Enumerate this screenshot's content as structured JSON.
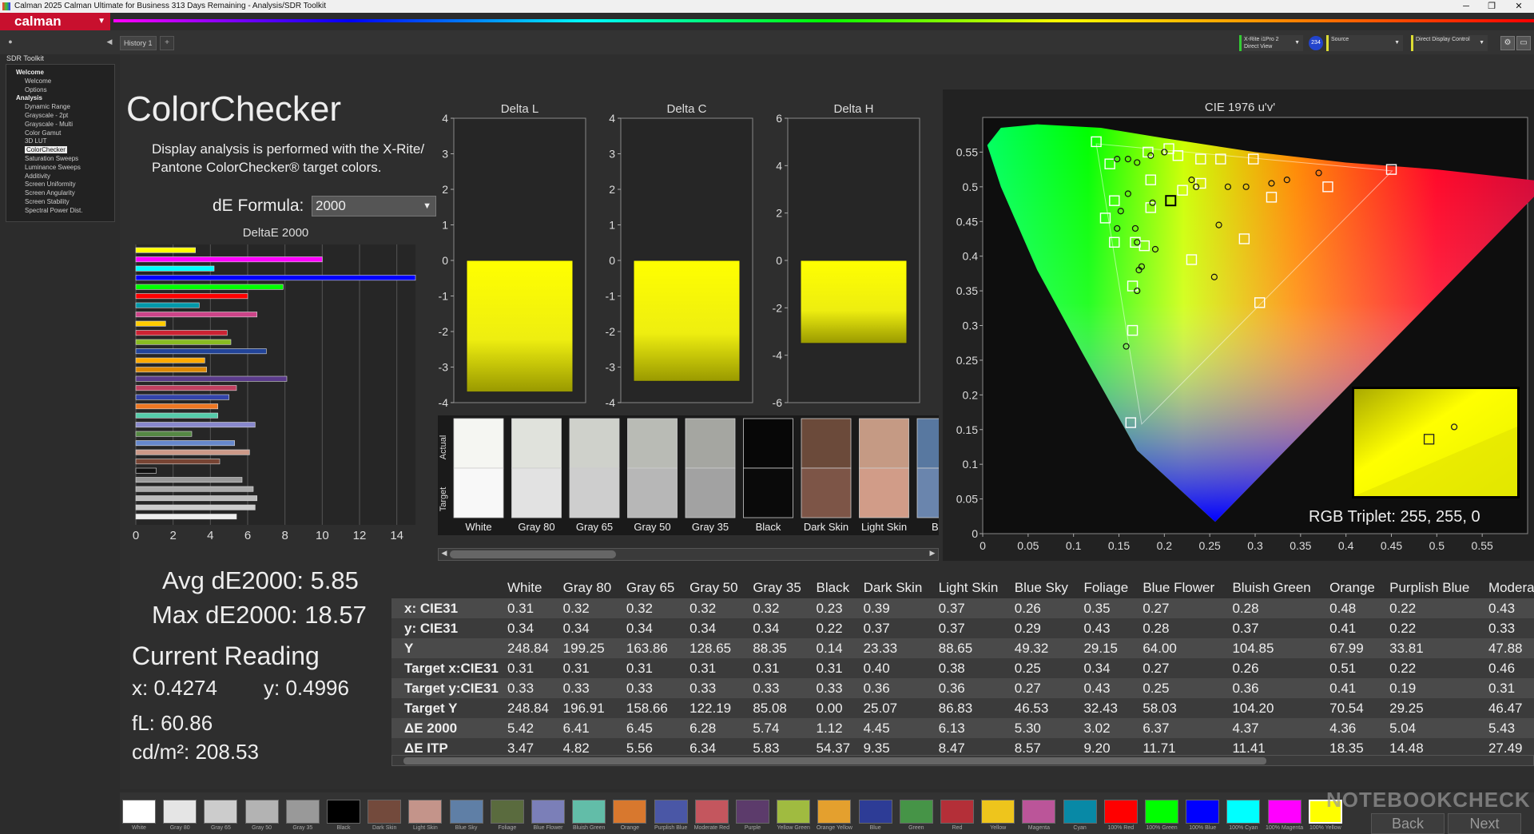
{
  "window": {
    "title": "Calman 2025 Calman Ultimate for Business 313 Days Remaining  - Analysis/SDR Toolkit",
    "minimize": "─",
    "restore": "❐",
    "close": "✕"
  },
  "brand": {
    "label": "calman"
  },
  "history_tab": "History 1",
  "history_add": "+",
  "devices": {
    "meter": {
      "line1": "X-Rite i1Pro 2",
      "line2": "Direct View"
    },
    "probe_badge": "234",
    "source": {
      "line1": "Source",
      "line2": ""
    },
    "display": {
      "line1": "Direct Display Control",
      "line2": ""
    }
  },
  "sidebar": {
    "header": "SDR Toolkit",
    "items": [
      {
        "label": "Welcome",
        "type": "section"
      },
      {
        "label": "Welcome",
        "type": "item"
      },
      {
        "label": "Options",
        "type": "item"
      },
      {
        "label": "Analysis",
        "type": "section"
      },
      {
        "label": "Dynamic Range",
        "type": "item"
      },
      {
        "label": "Grayscale - 2pt",
        "type": "item"
      },
      {
        "label": "Grayscale - Multi",
        "type": "item"
      },
      {
        "label": "Color Gamut",
        "type": "item"
      },
      {
        "label": "3D LUT",
        "type": "item"
      },
      {
        "label": "ColorChecker",
        "type": "selected"
      },
      {
        "label": "Saturation Sweeps",
        "type": "item"
      },
      {
        "label": "Luminance Sweeps",
        "type": "item"
      },
      {
        "label": "Additivity",
        "type": "item"
      },
      {
        "label": "Screen Uniformity",
        "type": "item"
      },
      {
        "label": "Screen Angularity",
        "type": "item"
      },
      {
        "label": "Screen Stability",
        "type": "item"
      },
      {
        "label": "Spectral Power Dist.",
        "type": "item"
      }
    ]
  },
  "page": {
    "title": "ColorChecker",
    "description": "Display analysis is performed with the X-Rite/ Pantone ColorChecker® target colors.",
    "de_formula_label": "dE Formula:",
    "de_formula_value": "2000",
    "avg": "Avg dE2000: 5.85",
    "max": "Max dE2000: 18.57",
    "current_reading_title": "Current Reading",
    "x": "x: 0.4274",
    "y": "y: 0.4996",
    "fl": "fL: 60.86",
    "cdm2": "cd/m²: 208.53"
  },
  "chart_data": [
    {
      "type": "bar",
      "title": "DeltaE 2000",
      "orientation": "horizontal",
      "xlim": [
        0,
        15
      ],
      "xticks": [
        0,
        2,
        4,
        6,
        8,
        10,
        12,
        14
      ],
      "bars": [
        {
          "value": 3.2,
          "color": "#ffff00"
        },
        {
          "value": 10.0,
          "color": "#ff00ff"
        },
        {
          "value": 4.2,
          "color": "#00ffff"
        },
        {
          "value": 15.0,
          "color": "#0000ff"
        },
        {
          "value": 7.9,
          "color": "#00ff00"
        },
        {
          "value": 6.0,
          "color": "#ff0000"
        },
        {
          "value": 3.4,
          "color": "#0099aa"
        },
        {
          "value": 6.5,
          "color": "#cc4488"
        },
        {
          "value": 1.6,
          "color": "#ffcc00"
        },
        {
          "value": 4.9,
          "color": "#cc2233"
        },
        {
          "value": 5.1,
          "color": "#88bb22"
        },
        {
          "value": 7.0,
          "color": "#224499"
        },
        {
          "value": 3.7,
          "color": "#ffaa00"
        },
        {
          "value": 3.8,
          "color": "#dd8800"
        },
        {
          "value": 8.1,
          "color": "#5a3a8a"
        },
        {
          "value": 5.4,
          "color": "#c04060"
        },
        {
          "value": 5.0,
          "color": "#3344aa"
        },
        {
          "value": 4.4,
          "color": "#ee7722"
        },
        {
          "value": 4.4,
          "color": "#55ccaa"
        },
        {
          "value": 6.4,
          "color": "#8888cc"
        },
        {
          "value": 3.0,
          "color": "#558844"
        },
        {
          "value": 5.3,
          "color": "#6688cc"
        },
        {
          "value": 6.1,
          "color": "#cc9988"
        },
        {
          "value": 4.5,
          "color": "#774433"
        },
        {
          "value": 1.1,
          "color": "#111111"
        },
        {
          "value": 5.7,
          "color": "#999999"
        },
        {
          "value": 6.3,
          "color": "#aaaaaa"
        },
        {
          "value": 6.5,
          "color": "#bbbbbb"
        },
        {
          "value": 6.4,
          "color": "#cccccc"
        },
        {
          "value": 5.4,
          "color": "#eeeeee"
        }
      ]
    },
    {
      "type": "bar",
      "title": "Delta L",
      "ylim": [
        -4,
        4
      ],
      "yticks": [
        4,
        3,
        2,
        1,
        0,
        -1,
        -2,
        -3,
        -4
      ],
      "values": [
        -3.7
      ]
    },
    {
      "type": "bar",
      "title": "Delta C",
      "ylim": [
        -4,
        4
      ],
      "yticks": [
        4,
        3,
        2,
        1,
        0,
        -1,
        -2,
        -3,
        -4
      ],
      "values": [
        -3.4
      ]
    },
    {
      "type": "bar",
      "title": "Delta H",
      "ylim": [
        -6,
        6
      ],
      "yticks": [
        6,
        4,
        2,
        0,
        -2,
        -4,
        -6
      ],
      "values": [
        -3.5
      ]
    },
    {
      "type": "scatter",
      "title": "CIE 1976 u'v'",
      "xlim": [
        0,
        0.6
      ],
      "ylim": [
        0,
        0.6
      ],
      "xticks": [
        "0",
        "0.05",
        "0.1",
        "0.15",
        "0.2",
        "0.25",
        "0.3",
        "0.35",
        "0.4",
        "0.45",
        "0.5",
        "0.55"
      ],
      "yticks": [
        "0.55",
        "0.5",
        "0.45",
        "0.4",
        "0.35",
        "0.3",
        "0.25",
        "0.2",
        "0.15",
        "0.1",
        "0.05",
        "0"
      ],
      "targets": [
        [
          0.125,
          0.565
        ],
        [
          0.14,
          0.533
        ],
        [
          0.145,
          0.48
        ],
        [
          0.135,
          0.455
        ],
        [
          0.145,
          0.42
        ],
        [
          0.168,
          0.42
        ],
        [
          0.178,
          0.415
        ],
        [
          0.165,
          0.357
        ],
        [
          0.165,
          0.293
        ],
        [
          0.163,
          0.16
        ],
        [
          0.185,
          0.47
        ],
        [
          0.185,
          0.51
        ],
        [
          0.182,
          0.55
        ],
        [
          0.205,
          0.555
        ],
        [
          0.215,
          0.545
        ],
        [
          0.24,
          0.54
        ],
        [
          0.24,
          0.505
        ],
        [
          0.22,
          0.495
        ],
        [
          0.262,
          0.54
        ],
        [
          0.298,
          0.54
        ],
        [
          0.318,
          0.485
        ],
        [
          0.38,
          0.5
        ],
        [
          0.45,
          0.525
        ],
        [
          0.288,
          0.425
        ],
        [
          0.23,
          0.395
        ],
        [
          0.305,
          0.333
        ]
      ],
      "measured": [
        [
          0.148,
          0.54
        ],
        [
          0.16,
          0.54
        ],
        [
          0.17,
          0.535
        ],
        [
          0.185,
          0.545
        ],
        [
          0.2,
          0.55
        ],
        [
          0.187,
          0.477
        ],
        [
          0.16,
          0.49
        ],
        [
          0.152,
          0.465
        ],
        [
          0.148,
          0.44
        ],
        [
          0.168,
          0.44
        ],
        [
          0.17,
          0.42
        ],
        [
          0.19,
          0.41
        ],
        [
          0.175,
          0.385
        ],
        [
          0.172,
          0.38
        ],
        [
          0.17,
          0.35
        ],
        [
          0.23,
          0.51
        ],
        [
          0.235,
          0.5
        ],
        [
          0.27,
          0.5
        ],
        [
          0.29,
          0.5
        ],
        [
          0.318,
          0.505
        ],
        [
          0.335,
          0.51
        ],
        [
          0.37,
          0.52
        ],
        [
          0.26,
          0.445
        ],
        [
          0.255,
          0.37
        ],
        [
          0.158,
          0.27
        ]
      ],
      "current": {
        "marker": [
          0.207,
          0.48
        ]
      },
      "inset": {
        "target": [
          0.46,
          0.47
        ],
        "measured": [
          0.61,
          0.36
        ]
      }
    }
  ],
  "rgb_triplet": "RGB Triplet: 255, 255, 0",
  "swatches": {
    "actual_label": "Actual",
    "target_label": "Target",
    "items": [
      {
        "name": "White",
        "actual": "#f5f6f2",
        "target": "#f8f8f8"
      },
      {
        "name": "Gray 80",
        "actual": "#e0e2dc",
        "target": "#e2e2e2"
      },
      {
        "name": "Gray 65",
        "actual": "#cfd1cb",
        "target": "#cecece"
      },
      {
        "name": "Gray 50",
        "actual": "#b9bbb5",
        "target": "#b7b7b7"
      },
      {
        "name": "Gray 35",
        "actual": "#a5a6a1",
        "target": "#a2a2a2"
      },
      {
        "name": "Black",
        "actual": "#070707",
        "target": "#0a0a0a"
      },
      {
        "name": "Dark Skin",
        "actual": "#6b4a3a",
        "target": "#7d5547"
      },
      {
        "name": "Light Skin",
        "actual": "#c59a84",
        "target": "#d19c88"
      },
      {
        "name": "Blue",
        "actual": "#5878a0",
        "target": "#6a85ad"
      }
    ]
  },
  "table": {
    "columns": [
      "",
      "White",
      "Gray 80",
      "Gray 65",
      "Gray 50",
      "Gray 35",
      "Black",
      "Dark Skin",
      "Light Skin",
      "Blue Sky",
      "Foliage",
      "Blue Flower",
      "Bluish Green",
      "Orange",
      "Purplish Blue",
      "Moderate"
    ],
    "rows": [
      [
        "x: CIE31",
        "0.31",
        "0.32",
        "0.32",
        "0.32",
        "0.32",
        "0.23",
        "0.39",
        "0.37",
        "0.26",
        "0.35",
        "0.27",
        "0.28",
        "0.48",
        "0.22",
        "0.43"
      ],
      [
        "y: CIE31",
        "0.34",
        "0.34",
        "0.34",
        "0.34",
        "0.34",
        "0.22",
        "0.37",
        "0.37",
        "0.29",
        "0.43",
        "0.28",
        "0.37",
        "0.41",
        "0.22",
        "0.33"
      ],
      [
        "Y",
        "248.84",
        "199.25",
        "163.86",
        "128.65",
        "88.35",
        "0.14",
        "23.33",
        "88.65",
        "49.32",
        "29.15",
        "64.00",
        "104.85",
        "67.99",
        "33.81",
        "47.88"
      ],
      [
        "Target x:CIE31",
        "0.31",
        "0.31",
        "0.31",
        "0.31",
        "0.31",
        "0.31",
        "0.40",
        "0.38",
        "0.25",
        "0.34",
        "0.27",
        "0.26",
        "0.51",
        "0.22",
        "0.46"
      ],
      [
        "Target y:CIE31",
        "0.33",
        "0.33",
        "0.33",
        "0.33",
        "0.33",
        "0.33",
        "0.36",
        "0.36",
        "0.27",
        "0.43",
        "0.25",
        "0.36",
        "0.41",
        "0.19",
        "0.31"
      ],
      [
        "Target Y",
        "248.84",
        "196.91",
        "158.66",
        "122.19",
        "85.08",
        "0.00",
        "25.07",
        "86.83",
        "46.53",
        "32.43",
        "58.03",
        "104.20",
        "70.54",
        "29.25",
        "46.47"
      ],
      [
        "ΔE 2000",
        "5.42",
        "6.41",
        "6.45",
        "6.28",
        "5.74",
        "1.12",
        "4.45",
        "6.13",
        "5.30",
        "3.02",
        "6.37",
        "4.37",
        "4.36",
        "5.04",
        "5.43"
      ],
      [
        "ΔE ITP",
        "3.47",
        "4.82",
        "5.56",
        "6.34",
        "5.83",
        "54.37",
        "9.35",
        "8.47",
        "8.57",
        "9.20",
        "11.71",
        "11.41",
        "18.35",
        "14.48",
        "27.49"
      ]
    ]
  },
  "bottom_swatches": [
    {
      "name": "White",
      "color": "#ffffff"
    },
    {
      "name": "Gray 80",
      "color": "#e5e5e5"
    },
    {
      "name": "Gray 65",
      "color": "#cccccc"
    },
    {
      "name": "Gray 50",
      "color": "#b3b3b3"
    },
    {
      "name": "Gray 35",
      "color": "#999999"
    },
    {
      "name": "Black",
      "color": "#000000"
    },
    {
      "name": "Dark Skin",
      "color": "#734a3c"
    },
    {
      "name": "Light Skin",
      "color": "#c4948a"
    },
    {
      "name": "Blue Sky",
      "color": "#5f7fa6"
    },
    {
      "name": "Foliage",
      "color": "#5a6b3e"
    },
    {
      "name": "Blue Flower",
      "color": "#7b7fb8"
    },
    {
      "name": "Bluish Green",
      "color": "#62bda8"
    },
    {
      "name": "Orange",
      "color": "#d8782e"
    },
    {
      "name": "Purplish Blue",
      "color": "#4a57a6"
    },
    {
      "name": "Moderate Red",
      "color": "#c4565e"
    },
    {
      "name": "Purple",
      "color": "#5c3b6b"
    },
    {
      "name": "Yellow Green",
      "color": "#a0bb40"
    },
    {
      "name": "Orange Yellow",
      "color": "#e4a02e"
    },
    {
      "name": "Blue",
      "color": "#2d3c96"
    },
    {
      "name": "Green",
      "color": "#469447"
    },
    {
      "name": "Red",
      "color": "#b42f38"
    },
    {
      "name": "Yellow",
      "color": "#eec51c"
    },
    {
      "name": "Magenta",
      "color": "#bb5599"
    },
    {
      "name": "Cyan",
      "color": "#0889a6"
    },
    {
      "name": "100% Red",
      "color": "#ff0000"
    },
    {
      "name": "100% Green",
      "color": "#00ff00"
    },
    {
      "name": "100% Blue",
      "color": "#0000ff"
    },
    {
      "name": "100% Cyan",
      "color": "#00ffff"
    },
    {
      "name": "100% Magenta",
      "color": "#ff00ff"
    },
    {
      "name": "100% Yellow",
      "color": "#ffff00"
    }
  ],
  "watermark": "NOTEBOOKCHECK",
  "nav": {
    "back": "Back",
    "next": "Next"
  },
  "colors": {
    "accent": "#c8102e",
    "highlight": "#ffff00"
  }
}
